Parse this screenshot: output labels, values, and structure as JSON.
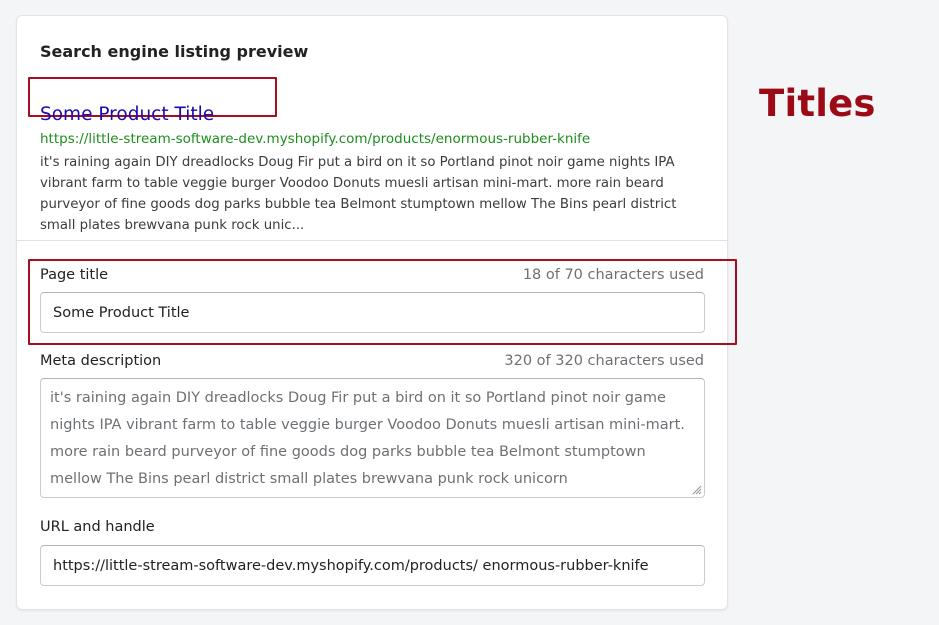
{
  "preview": {
    "section_title": "Search engine listing preview",
    "title": "Some Product Title",
    "url": "https://little-stream-software-dev.myshopify.com/products/enormous-rubber-knife",
    "description": "it's raining again DIY dreadlocks Doug Fir put a bird on it so Portland pinot noir game nights IPA vibrant farm to table veggie burger Voodoo Donuts muesli artisan mini-mart. more rain beard purveyor of fine goods dog parks bubble tea Belmont stumptown mellow The Bins pearl district small plates brewvana punk rock unic..."
  },
  "page_title_field": {
    "label": "Page title",
    "counter": "18 of 70 characters used",
    "value": "Some Product Title"
  },
  "meta_description_field": {
    "label": "Meta description",
    "counter": "320 of 320 characters used",
    "value": "it's raining again DIY dreadlocks Doug Fir put a bird on it so Portland pinot noir game nights IPA vibrant farm to table veggie burger Voodoo Donuts muesli artisan mini-mart. more rain beard purveyor of fine goods dog parks bubble tea Belmont stumptown mellow The Bins pearl district small plates brewvana punk rock unicorn"
  },
  "url_handle_field": {
    "label": "URL and handle",
    "value": "https://little-stream-software-dev.myshopify.com/products/ enormous-rubber-knife"
  },
  "annotation": {
    "label": "Titles",
    "color": "#9c0a16"
  },
  "colors": {
    "link_title": "#1a0dab",
    "link_url": "#1e8e1e",
    "highlight_box": "#a40e1f"
  }
}
